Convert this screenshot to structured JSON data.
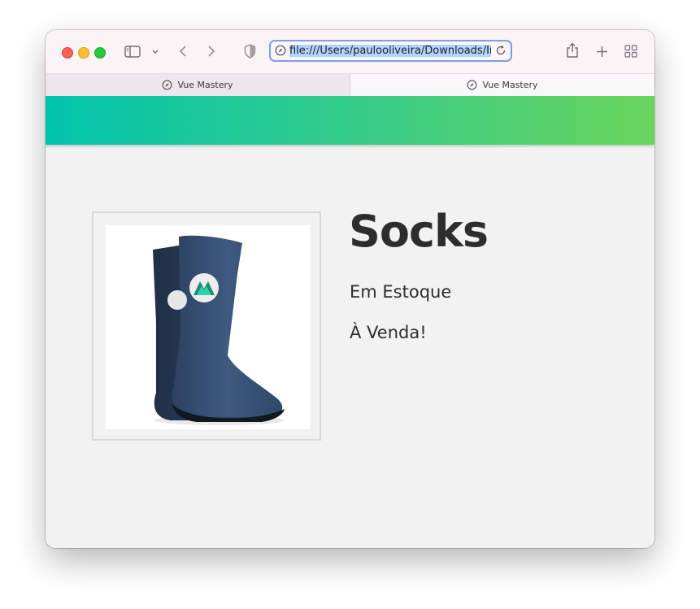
{
  "browser": {
    "url": "file:///Users/paulooliveira/Downloads/Intro",
    "tabs": [
      {
        "label": "Vue Mastery",
        "active": false
      },
      {
        "label": "Vue Mastery",
        "active": true
      }
    ]
  },
  "product": {
    "title": "Socks",
    "stock_status": "Em Estoque",
    "sale_status": "À Venda!",
    "image_icon": "socks-image"
  },
  "colors": {
    "navbar_gradient_start": "#00c4ad",
    "navbar_gradient_end": "#6ad55c",
    "url_focus_ring": "#7f9de8",
    "url_selection": "#b3d4fd"
  }
}
